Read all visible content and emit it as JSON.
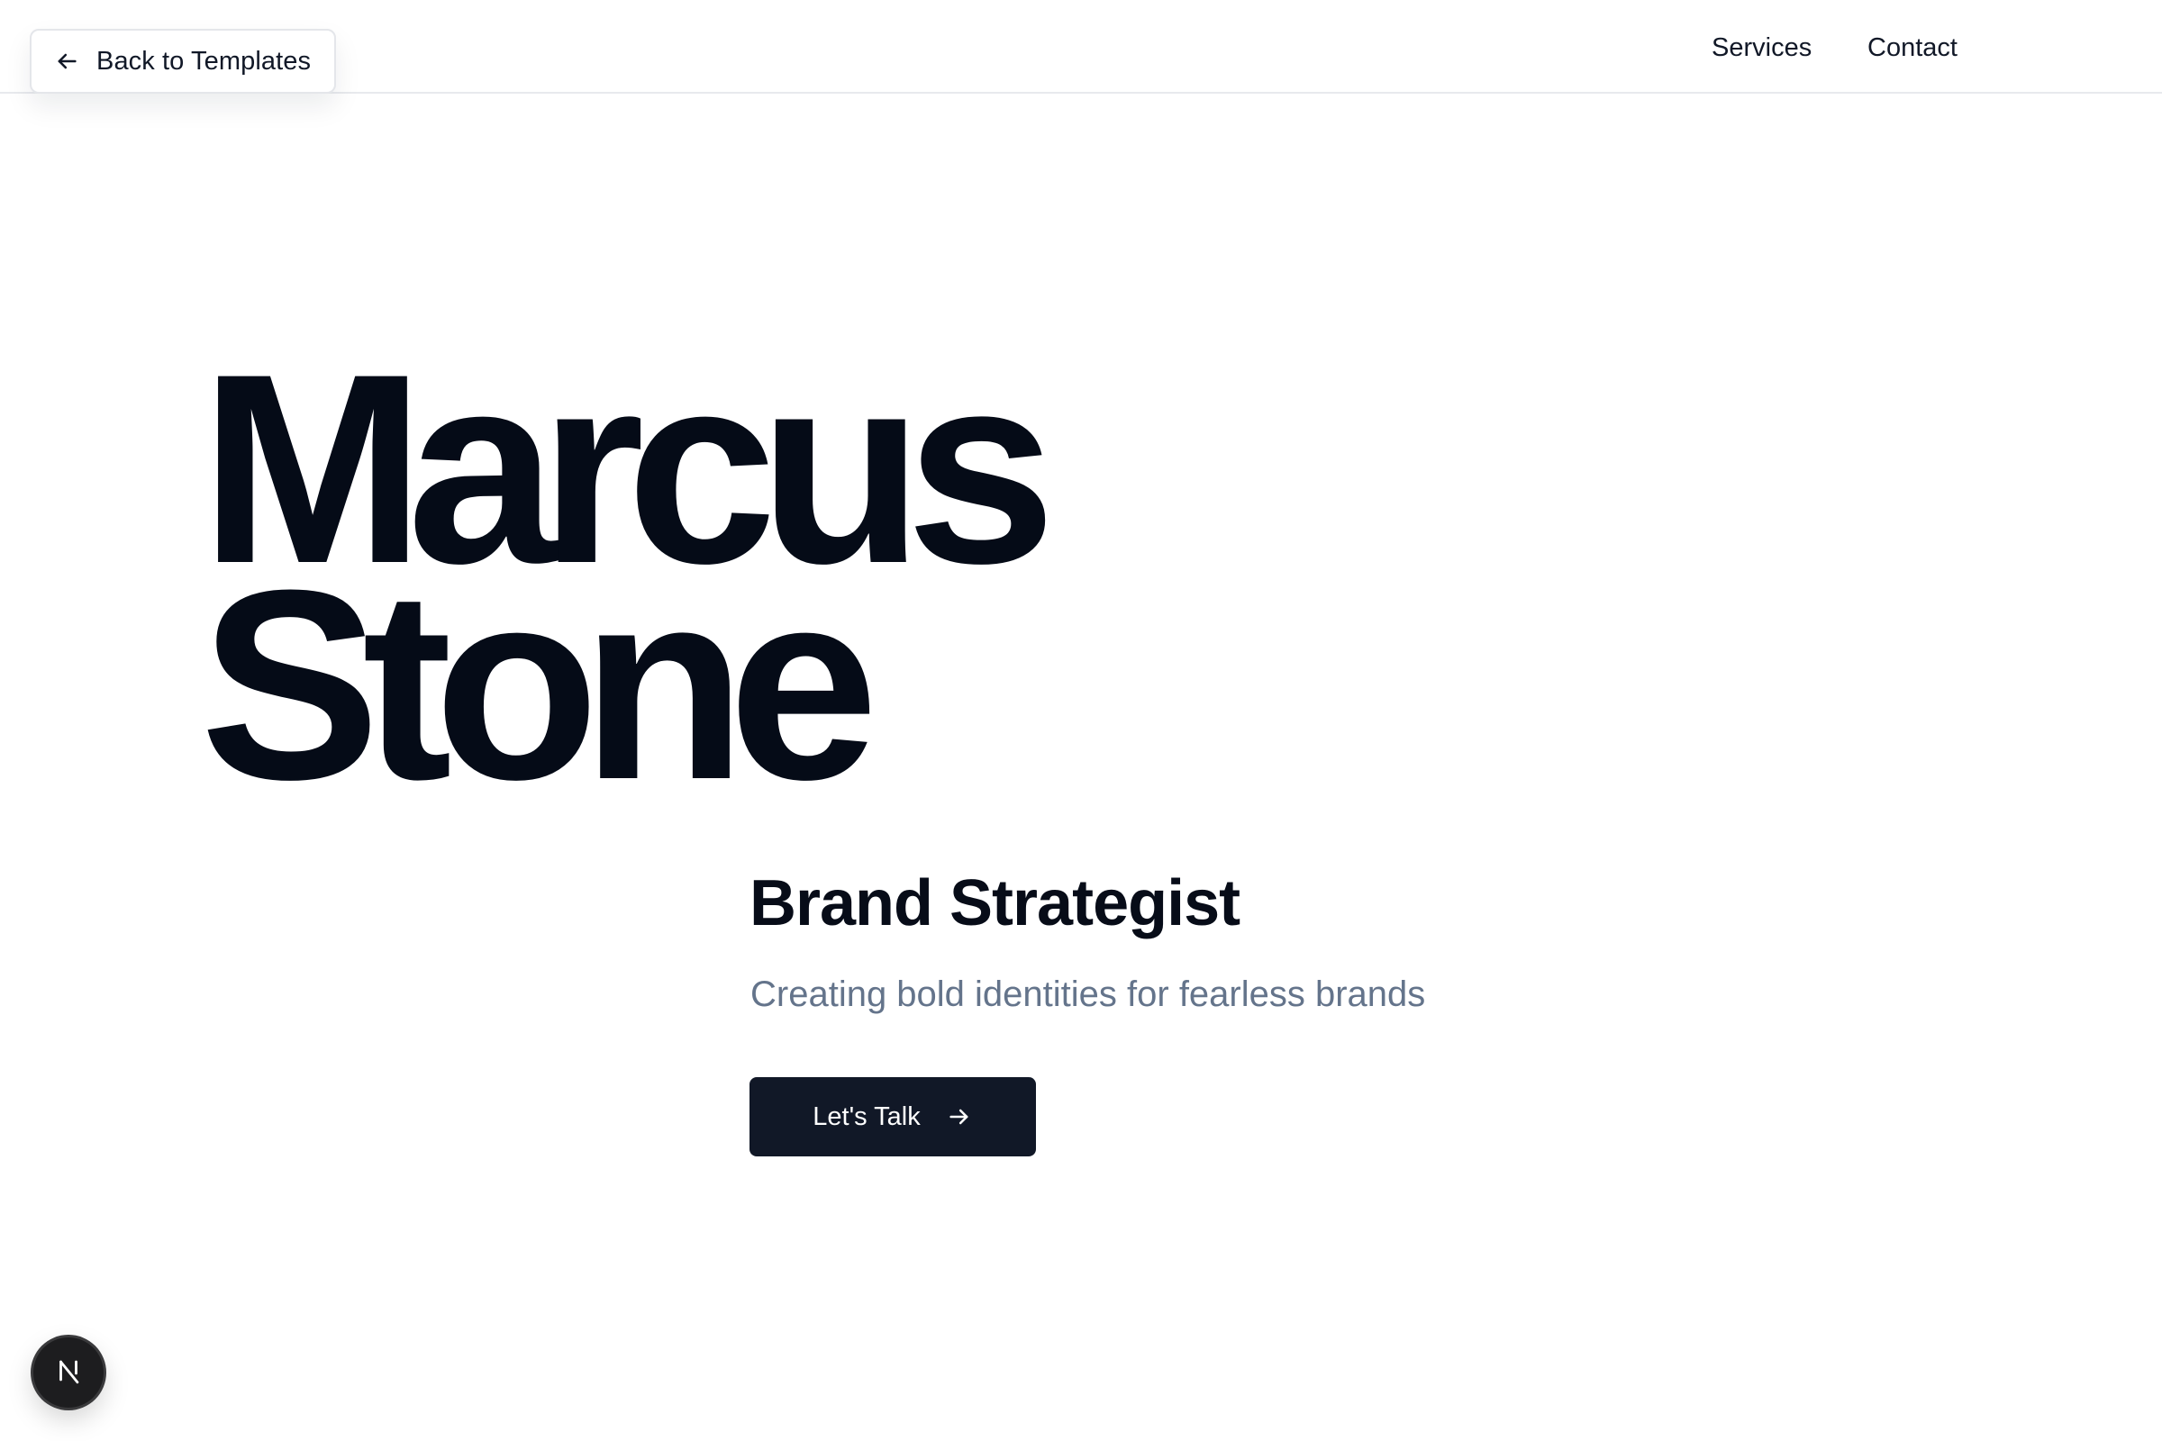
{
  "topbar": {
    "back_button": {
      "label": "Back to Templates",
      "icon": "arrow-left-icon"
    },
    "nav": {
      "items": [
        {
          "label": "Services"
        },
        {
          "label": "Contact"
        }
      ]
    }
  },
  "hero": {
    "name_line1": "Marcus",
    "name_line2": "Stone",
    "role": "Brand Strategist",
    "tagline": "Creating bold identities for fearless brands",
    "cta": {
      "label": "Let's Talk",
      "icon": "arrow-right-icon"
    }
  },
  "badge": {
    "icon": "nextjs-logo-icon"
  },
  "colors": {
    "text_primary": "#050b17",
    "text_muted": "#64748b",
    "cta_background": "#111827",
    "badge_background": "#1d1d1f",
    "page_background": "#ffffff"
  }
}
